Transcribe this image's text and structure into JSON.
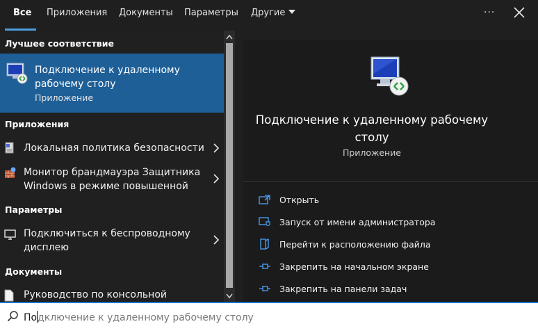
{
  "tabs": [
    {
      "label": "Все",
      "active": true
    },
    {
      "label": "Приложения"
    },
    {
      "label": "Документы"
    },
    {
      "label": "Параметры"
    },
    {
      "label": "Другие"
    }
  ],
  "more_label": "···",
  "sections": {
    "best": "Лучшее соответствие",
    "apps": "Приложения",
    "settings": "Параметры",
    "docs": "Документы"
  },
  "best_match": {
    "title": "Подключение к удаленному рабочему столу",
    "subtitle": "Приложение"
  },
  "apps": [
    {
      "label": "Локальная политика безопасности",
      "icon": "security-policy-icon"
    },
    {
      "label": "Монитор брандмауэра Защитника Windows в режиме повышенной",
      "icon": "firewall-icon"
    }
  ],
  "settings_items": [
    {
      "label": "Подключиться к беспроводному дисплею",
      "icon": "monitor-icon"
    }
  ],
  "docs_items": [
    {
      "label": "Руководство по консольной",
      "icon": "document-icon"
    }
  ],
  "detail": {
    "title": "Подключение к удаленному рабочему столу",
    "subtitle": "Приложение",
    "actions": [
      {
        "label": "Открыть",
        "icon": "open-icon"
      },
      {
        "label": "Запуск от имени администратора",
        "icon": "shield-admin-icon"
      },
      {
        "label": "Перейти к расположению файла",
        "icon": "folder-location-icon"
      },
      {
        "label": "Закрепить на начальном экране",
        "icon": "pin-icon"
      },
      {
        "label": "Закрепить на панели задач",
        "icon": "pin-icon"
      }
    ]
  },
  "search": {
    "typed": "По",
    "suggestion": "дключение к удаленному рабочему столу",
    "value": "По"
  },
  "colors": {
    "accent": "#4d9fe0",
    "selected": "#1f5f97",
    "background": "#1f1f1f"
  }
}
